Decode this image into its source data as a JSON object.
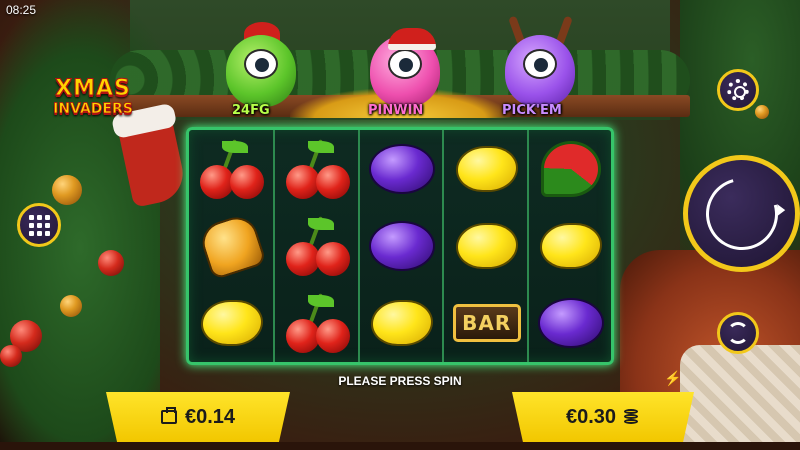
{
  "status_bar": {
    "time": "08:25"
  },
  "logo": {
    "line1": "XMAS",
    "line2": "INVADERS"
  },
  "features": [
    {
      "label": "24FG",
      "color": "#b8ff4a",
      "icon": "green-monster-icon"
    },
    {
      "label": "PINWIN",
      "color": "#ff6ed0",
      "icon": "pink-monster-icon"
    },
    {
      "label": "PICK'EM",
      "color": "#c98cff",
      "icon": "purple-monster-icon"
    }
  ],
  "reels": {
    "columns": [
      [
        "cherry",
        "bell",
        "lemon"
      ],
      [
        "cherry",
        "cherry",
        "cherry"
      ],
      [
        "plum",
        "plum",
        "lemon"
      ],
      [
        "lemon",
        "lemon",
        "bar"
      ],
      [
        "watermelon",
        "lemon",
        "plum"
      ]
    ],
    "bar_label": "BAR",
    "frame_color": "#36c46a"
  },
  "controls": {
    "menu": "grid-menu-icon",
    "settings": "gear-icon",
    "spin": "spin-icon",
    "autoplay": "autoplay-icon"
  },
  "message": "PLEASE PRESS SPIN",
  "balance": {
    "value": "€0.14",
    "icon": "wallet-icon"
  },
  "bet": {
    "value": "€0.30",
    "icon": "coin-stack-icon"
  },
  "colors": {
    "accent": "#f2c81a",
    "panel": "#ffe42a"
  }
}
